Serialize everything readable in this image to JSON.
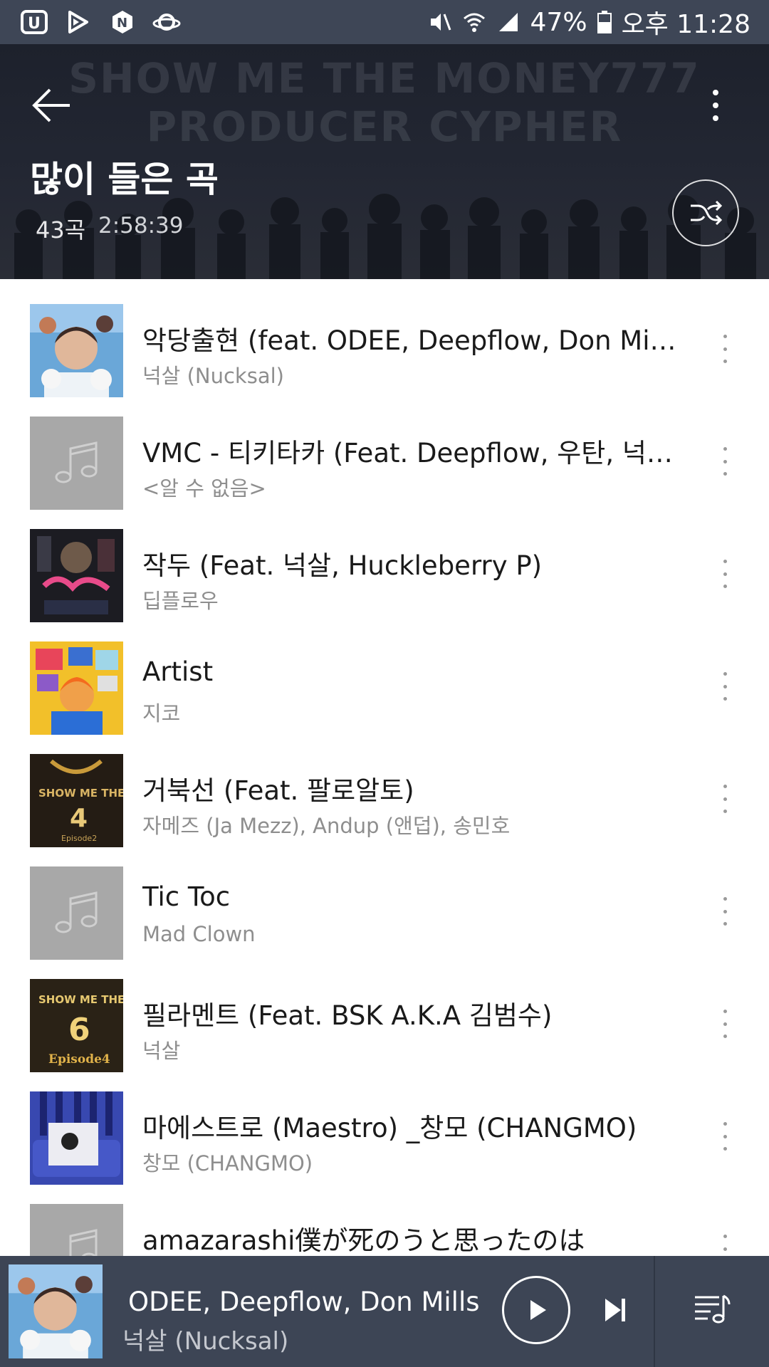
{
  "status_bar": {
    "battery": "47%",
    "time": "오후 11:28",
    "icons": [
      "u-plus-icon",
      "play-store-icon",
      "naver-icon",
      "planet-icon",
      "mute-icon",
      "wifi-icon",
      "signal-icon",
      "battery-icon"
    ]
  },
  "header": {
    "background_text_line1": "SHOW ME THE MONEY777",
    "background_text_line2": "PRODUCER CYPHER",
    "title": "많이 들은 곡",
    "count": "43곡",
    "duration": "2:58:39"
  },
  "songs": [
    {
      "title": "악당출현 (feat. ODEE, Deepflow, Don Mills,...",
      "artist": "넉살 (Nucksal)",
      "art": "album-cover-nucksal"
    },
    {
      "title": "VMC - 티키타카 (Feat. Deepflow, 우탄, 넉살,...",
      "artist": "<알 수 없음>",
      "art": "music-note-placeholder"
    },
    {
      "title": "작두 (Feat. 넉살, Huckleberry P)",
      "artist": "딥플로우",
      "art": "album-cover-yanghwa"
    },
    {
      "title": "Artist",
      "artist": "지코",
      "art": "album-cover-zico"
    },
    {
      "title": "거북선 (Feat. 팔로알토)",
      "artist": "자메즈 (Ja Mezz), Andup (앤덥), 송민호",
      "art": "album-cover-smtm4"
    },
    {
      "title": "Tic Toc",
      "artist": "Mad Clown",
      "art": "music-note-placeholder"
    },
    {
      "title": "필라멘트 (Feat. BSK A.K.A 김범수)",
      "artist": "넉살",
      "art": "album-cover-smtm6"
    },
    {
      "title": "마에스트로 (Maestro) _창모 (CHANGMO)",
      "artist": "창모 (CHANGMO)",
      "art": "album-cover-changmo"
    },
    {
      "title": "amazarashi僕が死のうと思ったのは",
      "artist": "",
      "art": "music-note-placeholder"
    }
  ],
  "album_text": {
    "smtm4_brand": "SHOW ME THE MONEY",
    "smtm4_number": "4",
    "smtm4_episode": "Episode2",
    "smtm6_brand": "SHOW ME THE MONEY",
    "smtm6_number": "6",
    "smtm6_episode": "Episode4"
  },
  "mini_player": {
    "title": "ODEE, Deepflow, Don Mills, 우",
    "artist": "넉살 (Nucksal)"
  },
  "colors": {
    "status_bar": "#3e4656",
    "mini_player": "#3d4555",
    "title_text": "#1a1a1a",
    "artist_text": "#8e8e8e",
    "placeholder": "#a8a8a8"
  }
}
